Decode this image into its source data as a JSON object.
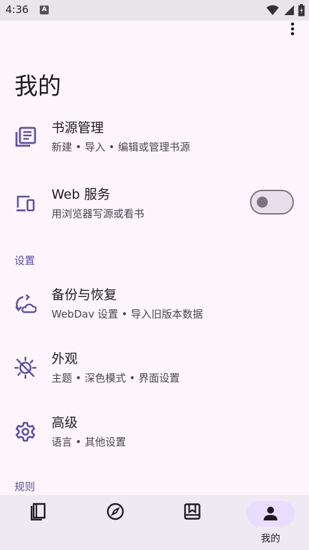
{
  "status_bar": {
    "time": "4:36",
    "notification_letter": "A"
  },
  "page": {
    "title": "我的"
  },
  "items": [
    {
      "title": "书源管理",
      "subtitle": "新建 • 导入 • 编辑或管理书源"
    },
    {
      "title": "Web 服务",
      "subtitle": "用浏览器写源或看书",
      "toggle_on": false
    },
    {
      "title": "备份与恢复",
      "subtitle": "WebDav 设置 • 导入旧版本数据"
    },
    {
      "title": "外观",
      "subtitle": "主题 • 深色模式 • 界面设置"
    },
    {
      "title": "高级",
      "subtitle": "语言 • 其他设置"
    }
  ],
  "sections": {
    "settings": "设置",
    "rules": "规则"
  },
  "bottom_nav": {
    "items": [
      {
        "icon": "bookshelf-icon",
        "label": ""
      },
      {
        "icon": "compass-icon",
        "label": ""
      },
      {
        "icon": "rss-icon",
        "label": ""
      },
      {
        "icon": "person-icon",
        "label": "我的",
        "active": true
      }
    ]
  },
  "colors": {
    "accent": "#5F4FA0",
    "background": "#FCF6FC",
    "nav_active": "#E9DDFF"
  }
}
